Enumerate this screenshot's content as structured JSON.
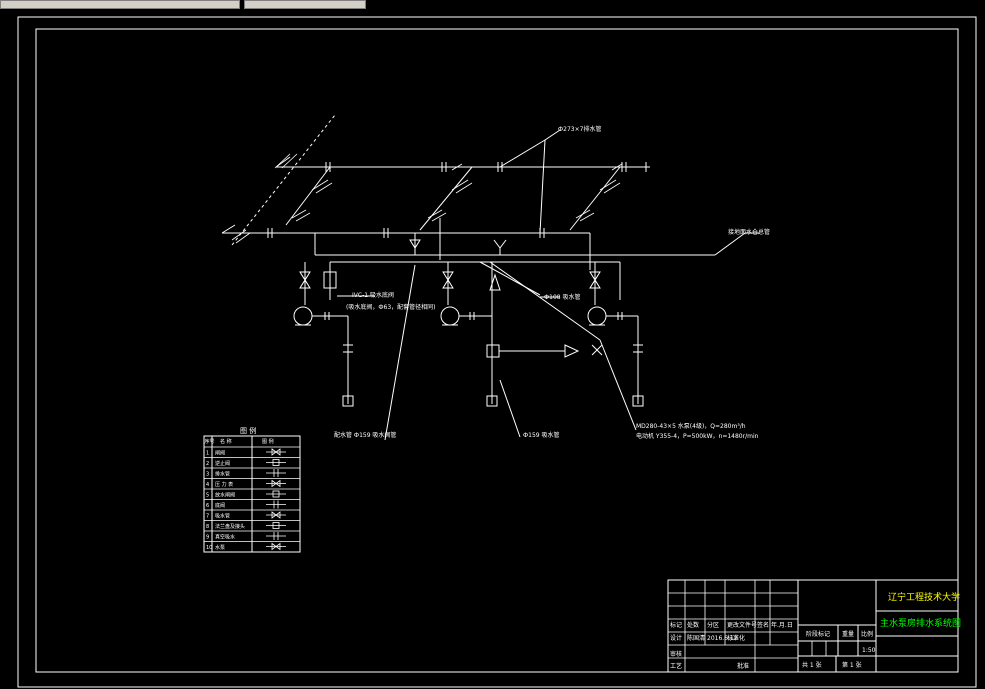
{
  "drawing": {
    "title_school": "辽宁工程技术大学",
    "title_drawing": "主水泵房排水系统图",
    "labels": {
      "top_pipe": "Ф273×7排水管",
      "right_pipe": "接地面水仓总管",
      "pump_left": "IVC-1 吸水底阀",
      "pump_left_sub": "(吸水底阀，Ф63，配套管径相同)",
      "mid_pipe": "Ф108 吸水管",
      "bottom_left": "配水管 Ф159 吸水阀管",
      "bottom_mid": "Ф159 吸水管",
      "bottom_right_1": "MD280-43×5 水泵(4级)，Q=280m³/h",
      "bottom_right_2": "电动机 Y355-4，P=500kW，n=1480r/min"
    }
  },
  "legend": {
    "title": "图 例",
    "headers": [
      "序号",
      "名  称",
      "图  例"
    ],
    "rows": [
      {
        "no": "1",
        "name": "闸阀",
        "symbol": "gate"
      },
      {
        "no": "2",
        "name": "逆止阀",
        "symbol": "check"
      },
      {
        "no": "3",
        "name": "排水管",
        "symbol": "pipe"
      },
      {
        "no": "4",
        "name": "压 力 表",
        "symbol": "gauge"
      },
      {
        "no": "5",
        "name": "放水闸阀",
        "symbol": "drain"
      },
      {
        "no": "6",
        "name": "底阀",
        "symbol": "foot"
      },
      {
        "no": "7",
        "name": "吸水管",
        "symbol": "suction"
      },
      {
        "no": "8",
        "name": "法兰盘及接头",
        "symbol": "flange"
      },
      {
        "no": "9",
        "name": "真空吸水",
        "symbol": "vacuum"
      },
      {
        "no": "10",
        "name": "水泵",
        "symbol": "pump"
      }
    ]
  },
  "titleblock": {
    "row_a": [
      "标记",
      "处数",
      "分区",
      "更改文件号",
      "签名",
      "年.月.日"
    ],
    "row_b": [
      "设计",
      "陈国清",
      "2016.6.12",
      "标准化"
    ],
    "stage": "阶段标记",
    "weight": "重量",
    "scale": "比例",
    "scale_val": "1:50",
    "review": "审核",
    "craft": "工艺",
    "approve": "批准",
    "sheets_total": "共 1 张",
    "sheet_no": "第 1 张"
  },
  "colors": {
    "line": "#ffffff",
    "text": "#ffffff",
    "school": "#ffff00",
    "drawing_title": "#00ff00"
  }
}
